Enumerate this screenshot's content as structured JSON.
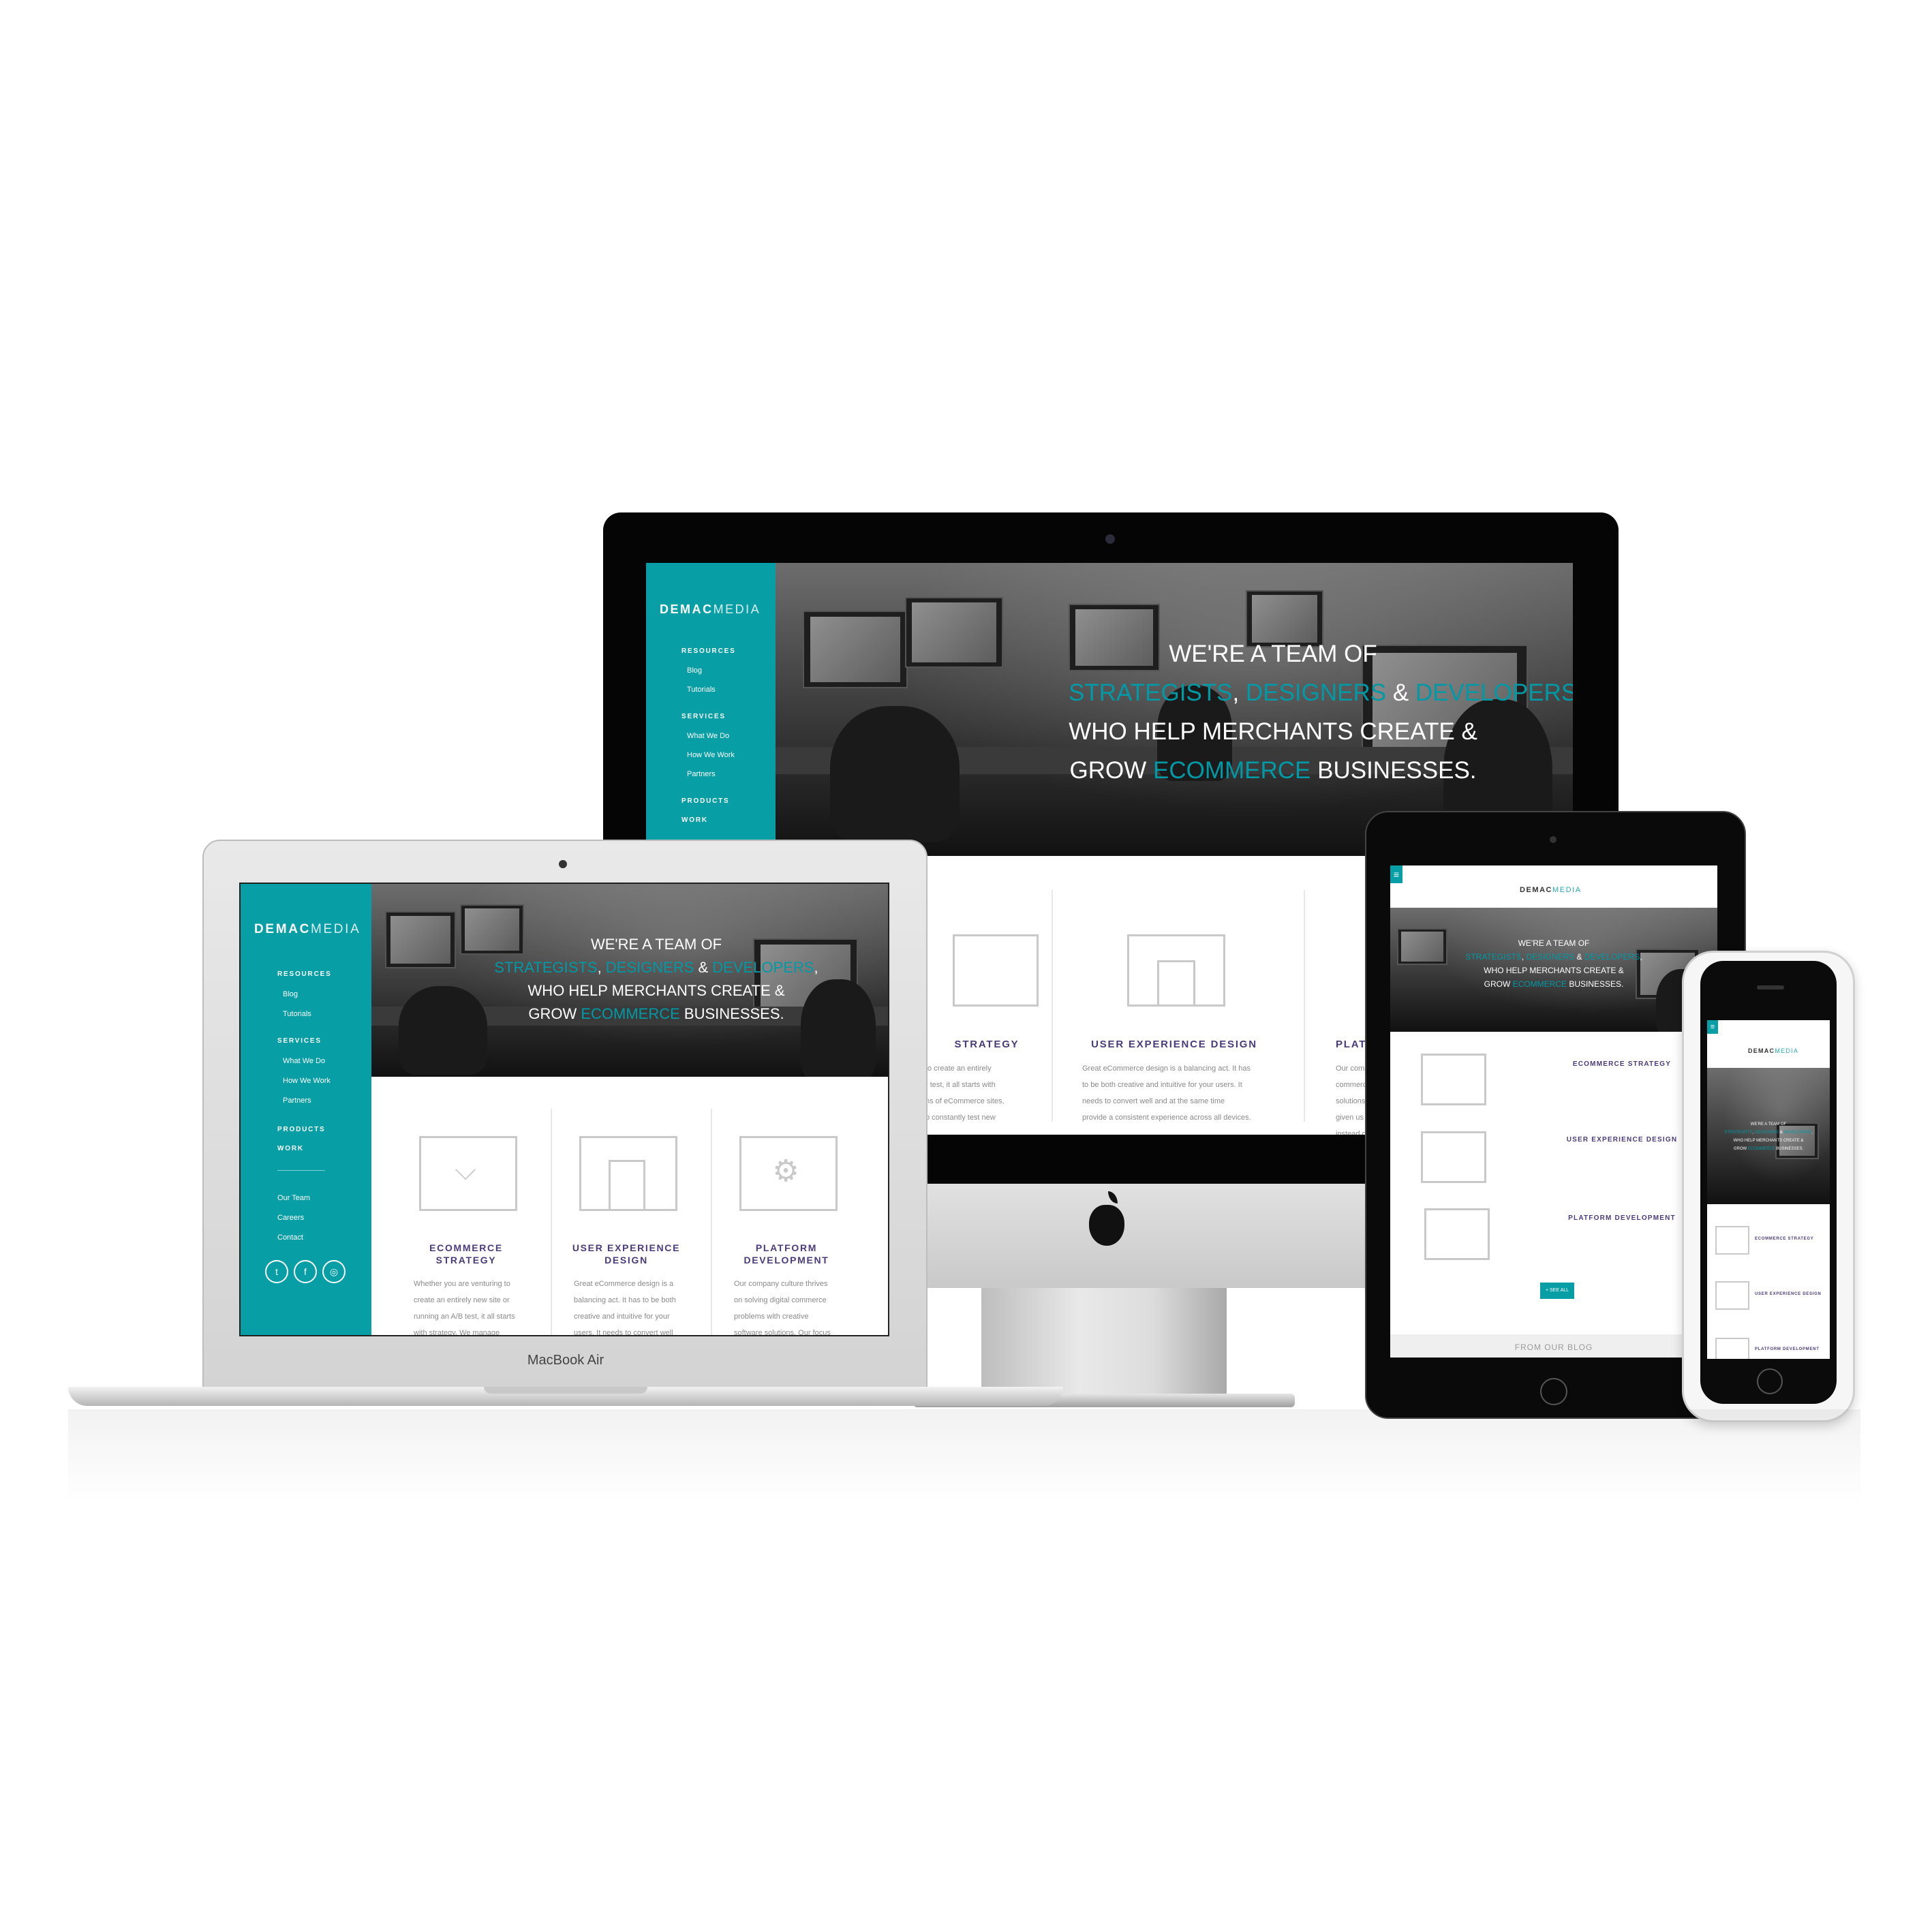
{
  "brand": {
    "bold": "DEMAC",
    "light": "MEDIA"
  },
  "sidebar": {
    "resources": "RESOURCES",
    "blog": "Blog",
    "tutorials": "Tutorials",
    "services": "SERVICES",
    "what_we_do": "What We Do",
    "how_we_work": "How We Work",
    "partners": "Partners",
    "products": "PRODUCTS",
    "work": "WORK",
    "our_team": "Our Team",
    "careers": "Careers",
    "contact": "Contact",
    "social": [
      "twitter-icon",
      "facebook-icon",
      "instagram-icon"
    ],
    "social_glyphs": [
      "t",
      "f",
      "◎"
    ]
  },
  "hero": {
    "line1": "WE'RE A TEAM OF",
    "strategists": "STRATEGISTS",
    "comma1": ", ",
    "designers": "DESIGNERS",
    "amp": " & ",
    "developers": "DEVELOPERS",
    "comma2": ",",
    "line3": "WHO HELP MERCHANTS CREATE &",
    "grow": "GROW ",
    "ecommerce": "ECOMMERCE",
    "businesses": " BUSINESSES."
  },
  "cards": {
    "ecommerce_title_1": "ECOMMERCE",
    "ecommerce_title_2": "STRATEGY",
    "ux_title_1": "USER EXPERIENCE",
    "ux_title_2": "DESIGN",
    "platform_title_1": "PLATFORM",
    "platform_title_2": "DEVELOPMENT",
    "ecommerce_body": [
      "Whether you are venturing to",
      "create an entirely new site or",
      "running an A/B test, it all starts",
      "with strategy. We manage"
    ],
    "ux_body": [
      "Great eCommerce design is a",
      "balancing act. It has to be both",
      "creative and intuitive for your",
      "users. It needs to convert well"
    ],
    "platform_body": [
      "Our company culture thrives",
      "on solving digital commerce",
      "problems with creative",
      "software solutions. Our focus"
    ]
  },
  "imac_cards": {
    "strategy": "STRATEGY",
    "ux": "USER EXPERIENCE DESIGN",
    "platform_partial": "PLAT",
    "strategy_body": [
      "to create an entirely",
      "r test, it all starts with",
      "ns of eCommerce sites,",
      "o constantly test new"
    ],
    "ux_body": [
      "Great eCommerce design is a balancing act. It has",
      "to be both creative and intuitive for your users. It",
      "needs to convert well and at the same time",
      "provide a consistent experience across all devices."
    ],
    "platform_body": [
      "Our compa",
      "commerce",
      "solutions.",
      "given us th",
      "instead of"
    ]
  },
  "tablet": {
    "ecommerce": "ECOMMERCE STRATEGY",
    "ux": "USER EXPERIENCE DESIGN",
    "platform": "PLATFORM DEVELOPMENT",
    "see_all": "+ SEE ALL",
    "from_blog": "FROM OUR BLOG"
  },
  "phone": {
    "ecommerce": "ECOMMERCE STRATEGY",
    "ux": "USER EXPERIENCE DESIGN",
    "platform": "PLATFORM DEVELOPMENT"
  },
  "devices": {
    "macbook_label": "MacBook Air"
  },
  "colors": {
    "teal": "#079ea6",
    "purple": "#4a3b7a"
  }
}
